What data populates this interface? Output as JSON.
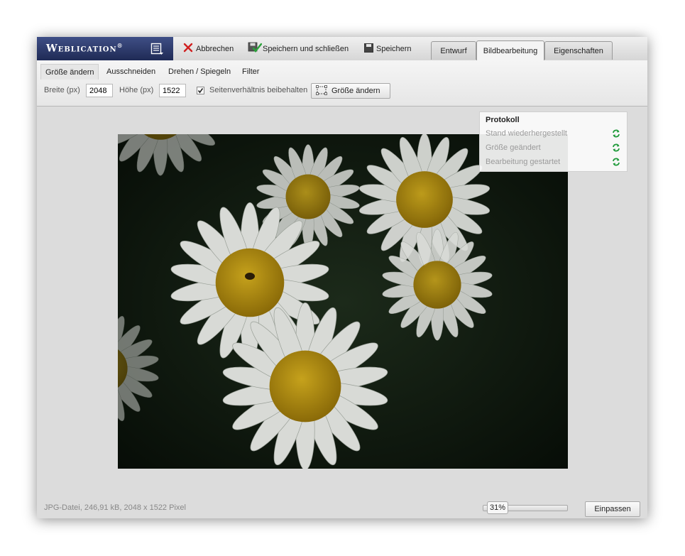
{
  "brand": {
    "name": "Weblication",
    "mark": "®"
  },
  "toolbar": {
    "cancel_label": "Abbrechen",
    "save_close_label": "Speichern und schließen",
    "save_label": "Speichern"
  },
  "tabs": [
    {
      "label": "Entwurf",
      "active": false
    },
    {
      "label": "Bildbearbeitung",
      "active": true
    },
    {
      "label": "Eigenschaften",
      "active": false
    }
  ],
  "subtabs": [
    {
      "label": "Größe ändern",
      "active": true
    },
    {
      "label": "Ausschneiden",
      "active": false
    },
    {
      "label": "Drehen / Spiegeln",
      "active": false
    },
    {
      "label": "Filter",
      "active": false
    }
  ],
  "resize": {
    "width_label": "Breite (px)",
    "width_value": "2048",
    "height_label": "Höhe (px)",
    "height_value": "1522",
    "keep_ratio_label": "Seitenverhältnis beibehalten",
    "keep_ratio_checked": true,
    "apply_label": "Größe ändern"
  },
  "protocol": {
    "title": "Protokoll",
    "entries": [
      {
        "label": "Stand wiederhergestellt"
      },
      {
        "label": "Größe geändert"
      },
      {
        "label": "Bearbeitung gestartet"
      }
    ]
  },
  "footer": {
    "file_info": "JPG-Datei, 246,91 kB, 2048 x 1522 Pixel",
    "zoom": "31%",
    "fit_label": "Einpassen"
  },
  "colors": {
    "brand_bg": "#2a3668",
    "cancel_red": "#d01f1f",
    "undo_green": "#1f9a3a"
  }
}
